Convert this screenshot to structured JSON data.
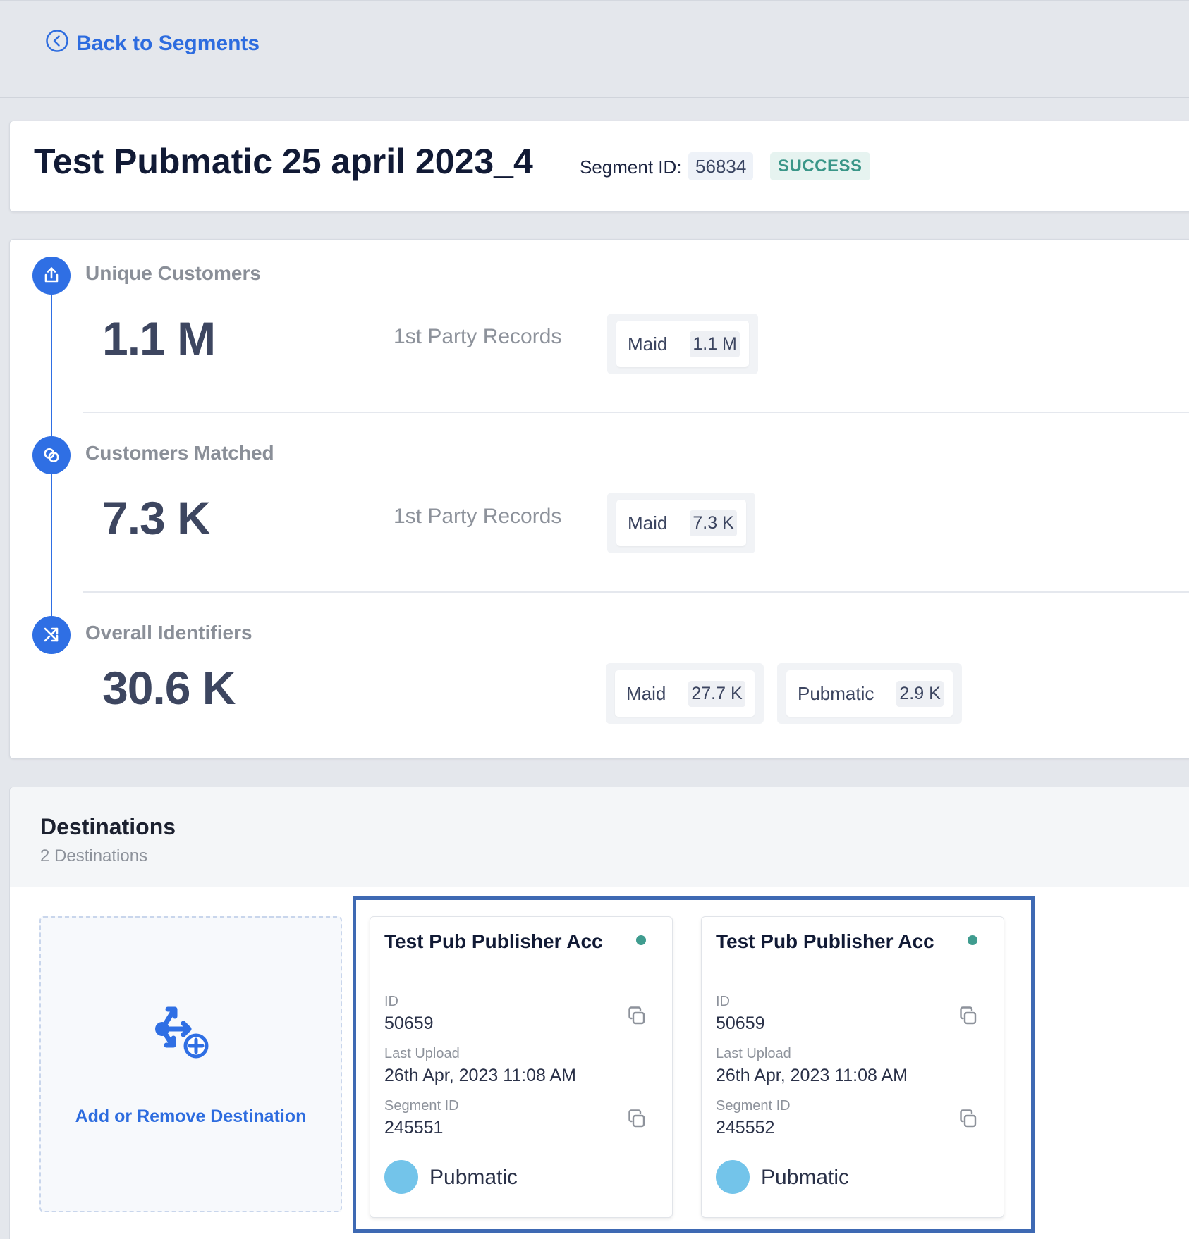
{
  "nav": {
    "back_label": "Back to Segments"
  },
  "segment": {
    "title": "Test Pubmatic 25 april 2023_4",
    "id_label": "Segment ID:",
    "id_value": "56834",
    "status": "SUCCESS"
  },
  "metrics": [
    {
      "label": "Unique Customers",
      "value": "1.1 M",
      "records_label": "1st Party Records",
      "icon": "upload-icon",
      "chips": [
        {
          "label": "Maid",
          "value": "1.1 M"
        }
      ]
    },
    {
      "label": "Customers Matched",
      "value": "7.3 K",
      "records_label": "1st Party Records",
      "icon": "link-icon",
      "chips": [
        {
          "label": "Maid",
          "value": "7.3 K"
        }
      ]
    },
    {
      "label": "Overall Identifiers",
      "value": "30.6 K",
      "records_label": "",
      "icon": "shuffle-icon",
      "chips": [
        {
          "label": "Maid",
          "value": "27.7 K"
        },
        {
          "label": "Pubmatic",
          "value": "2.9 K"
        }
      ]
    }
  ],
  "destinations": {
    "title": "Destinations",
    "count_label": "2 Destinations",
    "add_label": "Add or Remove Destination",
    "cards": [
      {
        "title": "Test Pub Publisher Acc",
        "id_label": "ID",
        "id_value": "50659",
        "last_upload_label": "Last Upload",
        "last_upload_value": "26th Apr, 2023 11:08 AM",
        "segment_id_label": "Segment ID",
        "segment_id_value": "245551",
        "platform": "Pubmatic"
      },
      {
        "title": "Test Pub Publisher Acc",
        "id_label": "ID",
        "id_value": "50659",
        "last_upload_label": "Last Upload",
        "last_upload_value": "26th Apr, 2023 11:08 AM",
        "segment_id_label": "Segment ID",
        "segment_id_value": "245552",
        "platform": "Pubmatic"
      }
    ]
  },
  "colors": {
    "accent": "#2f6fe4",
    "success_text": "#3a9688",
    "status_dot": "#3f9c8f",
    "platform_avatar": "#73c4ea",
    "highlight_frame": "#3e69b3"
  }
}
